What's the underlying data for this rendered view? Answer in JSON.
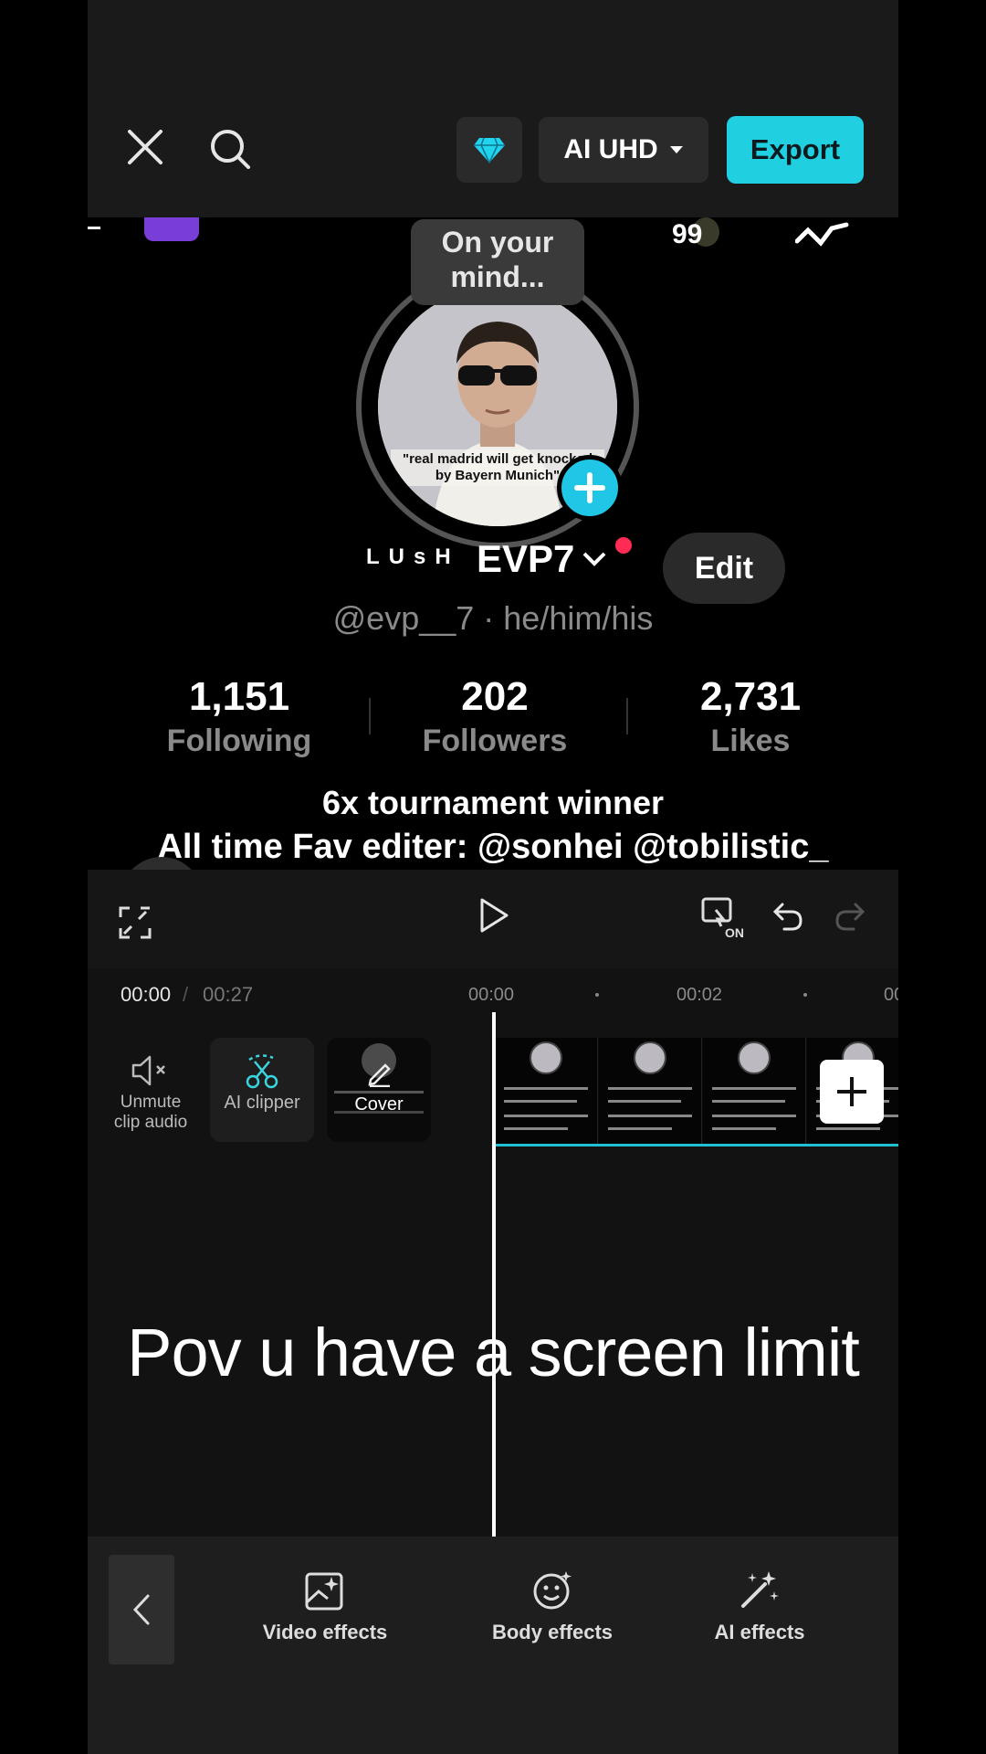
{
  "topbar": {
    "resolution_label": "AI UHD",
    "export_label": "Export",
    "accent_color": "#20d0e0"
  },
  "preview": {
    "top_count": "99",
    "mind_bubble": "On your mind...",
    "avatar_caption_1": "\"real madrid will get knocked",
    "avatar_caption_2": "by Bayern Munich\"",
    "name_prefix": "LUsH",
    "username": "EVP7",
    "edit_label": "Edit",
    "handle": "@evp__7 · he/him/his",
    "stats": [
      {
        "value": "1,151",
        "label": "Following"
      },
      {
        "value": "202",
        "label": "Followers"
      },
      {
        "value": "2,731",
        "label": "Likes"
      }
    ],
    "bio_line_1": "6x tournament winner",
    "bio_line_2": "All time Fav editer: @sonhei  @tobilistic_"
  },
  "timeline": {
    "current_time": "00:00",
    "separator": "/",
    "total_time": "00:27",
    "ruler": [
      "00:00",
      "00:02",
      "00"
    ],
    "tools": [
      {
        "label_1": "Unmute",
        "label_2": "clip audio",
        "icon": "speaker-muted-icon"
      },
      {
        "label": "AI clipper",
        "icon": "scissors-icon"
      }
    ],
    "cover_label": "Cover",
    "caption": "Pov u have a screen limit"
  },
  "bottom_toolbar": {
    "items": [
      {
        "label": "Video effects",
        "icon": "image-sparkle-icon"
      },
      {
        "label": "Body effects",
        "icon": "face-sparkle-icon"
      },
      {
        "label": "AI effects",
        "icon": "magic-wand-icon"
      }
    ]
  }
}
